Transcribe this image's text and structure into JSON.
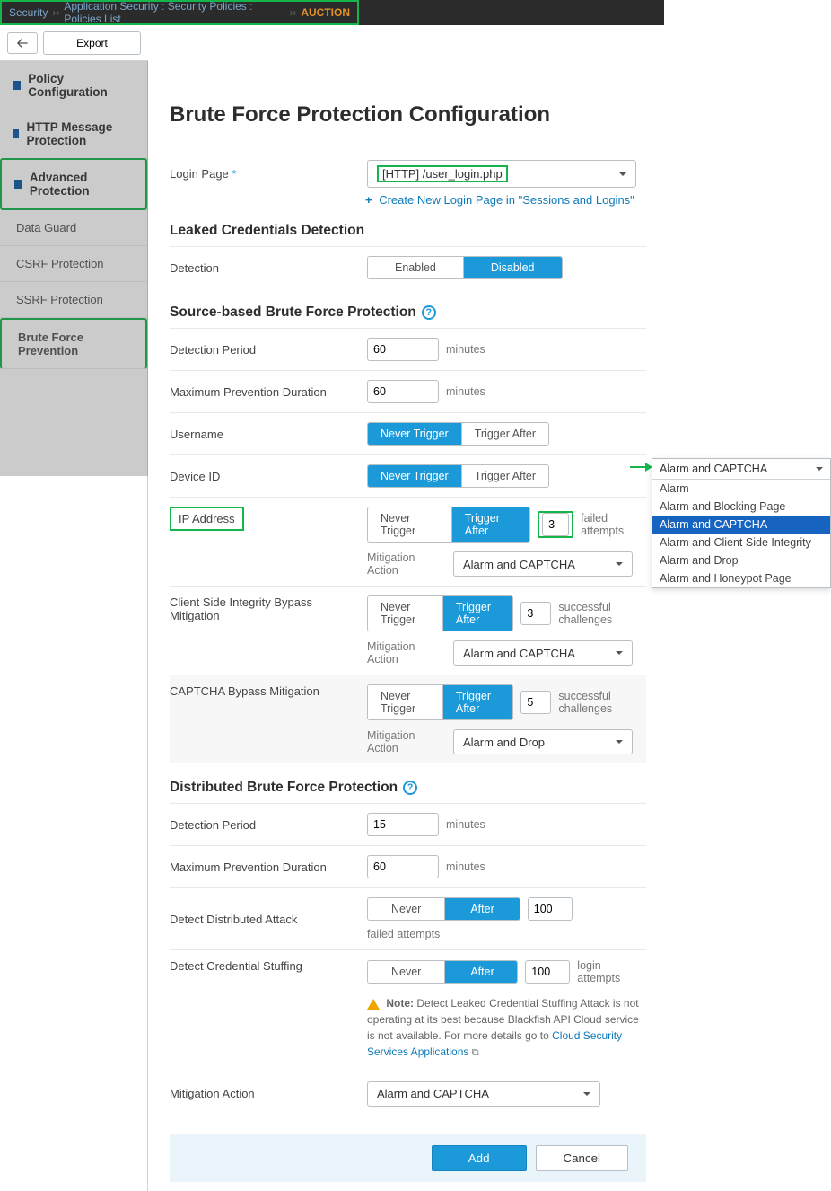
{
  "breadcrumb": {
    "root": "Security",
    "path1": "Application Security : Security Policies : Policies List",
    "current": "AUCTION",
    "sep": "››"
  },
  "toolbar": {
    "back": "←",
    "export": "Export"
  },
  "sidebar": {
    "grp1": "Policy Configuration",
    "grp2": "HTTP Message Protection",
    "grp3": "Advanced Protection",
    "items": [
      "Data Guard",
      "CSRF Protection",
      "SSRF Protection",
      "Brute Force Prevention"
    ]
  },
  "page": {
    "title": "Brute Force Protection Configuration"
  },
  "login": {
    "label": "Login Page",
    "required": "*",
    "value": "[HTTP] /user_login.php",
    "create_link": "Create New Login Page in \"Sessions and Logins\""
  },
  "leaked": {
    "title": "Leaked Credentials Detection",
    "label": "Detection",
    "enabled": "Enabled",
    "disabled": "Disabled"
  },
  "source": {
    "title": "Source-based Brute Force Protection",
    "detection_period": {
      "label": "Detection Period",
      "value": "60",
      "unit": "minutes"
    },
    "max_prev": {
      "label": "Maximum Prevention Duration",
      "value": "60",
      "unit": "minutes"
    },
    "username": {
      "label": "Username",
      "never": "Never Trigger",
      "after": "Trigger After"
    },
    "device": {
      "label": "Device ID",
      "never": "Never Trigger",
      "after": "Trigger After"
    },
    "ip": {
      "label": "IP Address",
      "never": "Never Trigger",
      "after": "Trigger After",
      "count": "3",
      "unit": "failed attempts",
      "mit_label": "Mitigation Action",
      "mit_value": "Alarm and CAPTCHA"
    },
    "client": {
      "label": "Client Side Integrity Bypass Mitigation",
      "never": "Never Trigger",
      "after": "Trigger After",
      "count": "3",
      "unit": "successful challenges",
      "mit_label": "Mitigation Action",
      "mit_value": "Alarm and CAPTCHA"
    },
    "captcha": {
      "label": "CAPTCHA Bypass Mitigation",
      "never": "Never Trigger",
      "after": "Trigger After",
      "count": "5",
      "unit": "successful challenges",
      "mit_label": "Mitigation Action",
      "mit_value": "Alarm and Drop"
    }
  },
  "dist": {
    "title": "Distributed Brute Force Protection",
    "detection_period": {
      "label": "Detection Period",
      "value": "15",
      "unit": "minutes"
    },
    "max_prev": {
      "label": "Maximum Prevention Duration",
      "value": "60",
      "unit": "minutes"
    },
    "detect_attack": {
      "label": "Detect Distributed Attack",
      "never": "Never",
      "after": "After",
      "count": "100",
      "unit": "failed attempts"
    },
    "detect_stuff": {
      "label": "Detect Credential Stuffing",
      "never": "Never",
      "after": "After",
      "count": "100",
      "unit": "login attempts"
    },
    "note_prefix": "Note:",
    "note": " Detect Leaked Credential Stuffing Attack is not operating at its best because Blackfish API Cloud service is not available. For more details go to ",
    "note_link": "Cloud Security Services Applications",
    "mit_label": "Mitigation Action",
    "mit_value": "Alarm and CAPTCHA"
  },
  "dropdown": {
    "head": "Alarm and CAPTCHA",
    "options": [
      "Alarm",
      "Alarm and Blocking Page",
      "Alarm and CAPTCHA",
      "Alarm and Client Side Integrity",
      "Alarm and Drop",
      "Alarm and Honeypot Page"
    ]
  },
  "footer": {
    "add": "Add",
    "cancel": "Cancel"
  }
}
